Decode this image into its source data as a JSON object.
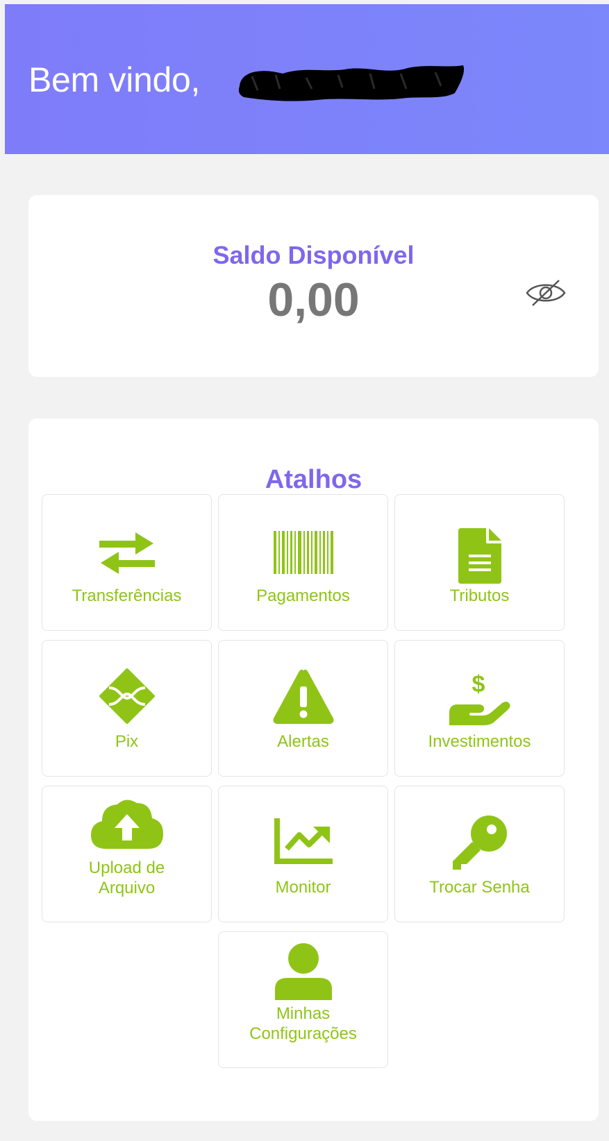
{
  "header": {
    "greeting": "Bem vindo,"
  },
  "balance": {
    "title": "Saldo Disponível",
    "value": "0,00"
  },
  "shortcuts": {
    "title": "Atalhos",
    "items": [
      {
        "label": "Transferências",
        "icon": "arrows-exchange-icon"
      },
      {
        "label": "Pagamentos",
        "icon": "barcode-icon"
      },
      {
        "label": "Tributos",
        "icon": "document-icon"
      },
      {
        "label": "Pix",
        "icon": "pix-icon"
      },
      {
        "label": "Alertas",
        "icon": "warning-icon"
      },
      {
        "label": "Investimentos",
        "icon": "hand-dollar-icon"
      },
      {
        "label": "Upload de\nArquivo",
        "icon": "cloud-upload-icon"
      },
      {
        "label": "Monitor",
        "icon": "chart-line-icon"
      },
      {
        "label": "Trocar Senha",
        "icon": "key-icon"
      },
      {
        "label": "Minhas\nConfigurações",
        "icon": "user-icon"
      }
    ]
  },
  "colors": {
    "header_bg": "#7c87fb",
    "title_purple": "#7f67ec",
    "accent_green": "#8fc417",
    "balance_gray": "#777777"
  }
}
